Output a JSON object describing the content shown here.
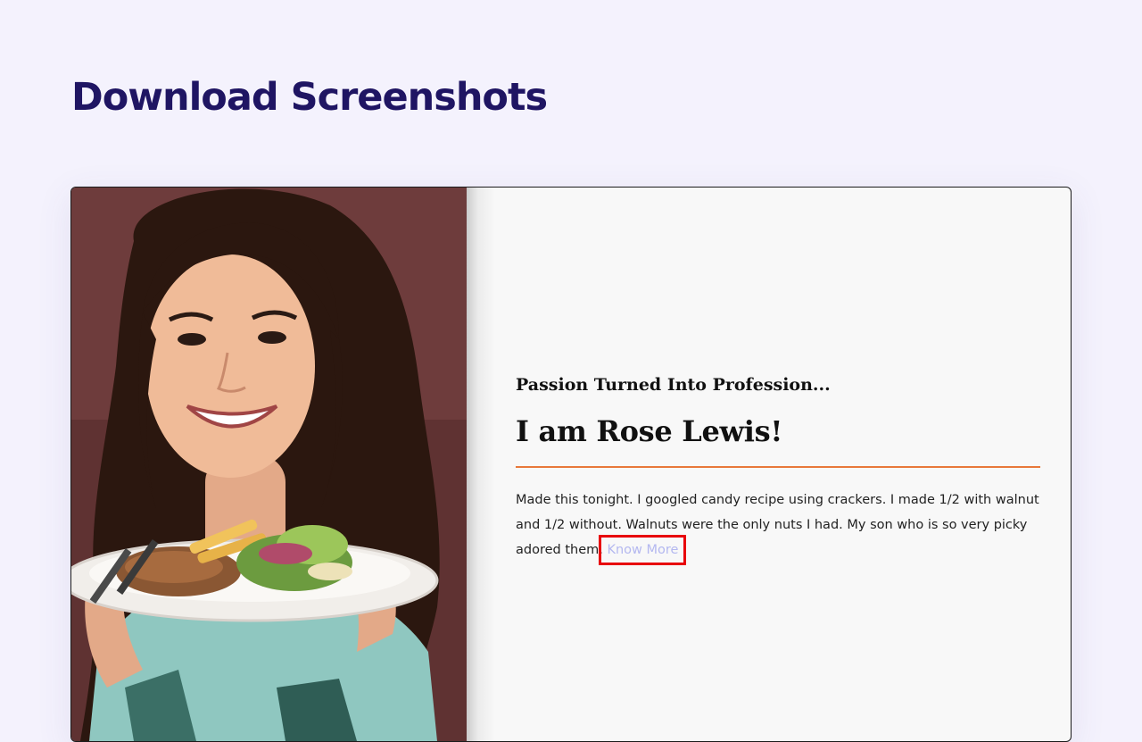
{
  "page": {
    "title": "Download Screenshots"
  },
  "card": {
    "photo_alt": "Woman smiling holding a plate of food",
    "tagline": "Passion Turned Into Profession...",
    "heading": "I am Rose Lewis!",
    "body": "Made this tonight. I googled candy recipe using crackers. I made 1/2 with walnut and 1/2 without. Walnuts were the only nuts I had. My son who is so very picky adored them.",
    "link_label": "Know More"
  },
  "colors": {
    "title": "#1f1563",
    "divider": "#e8783a",
    "link": "#b4b8f0",
    "highlight_box": "#e8000b",
    "background": "#f4f2fd"
  }
}
